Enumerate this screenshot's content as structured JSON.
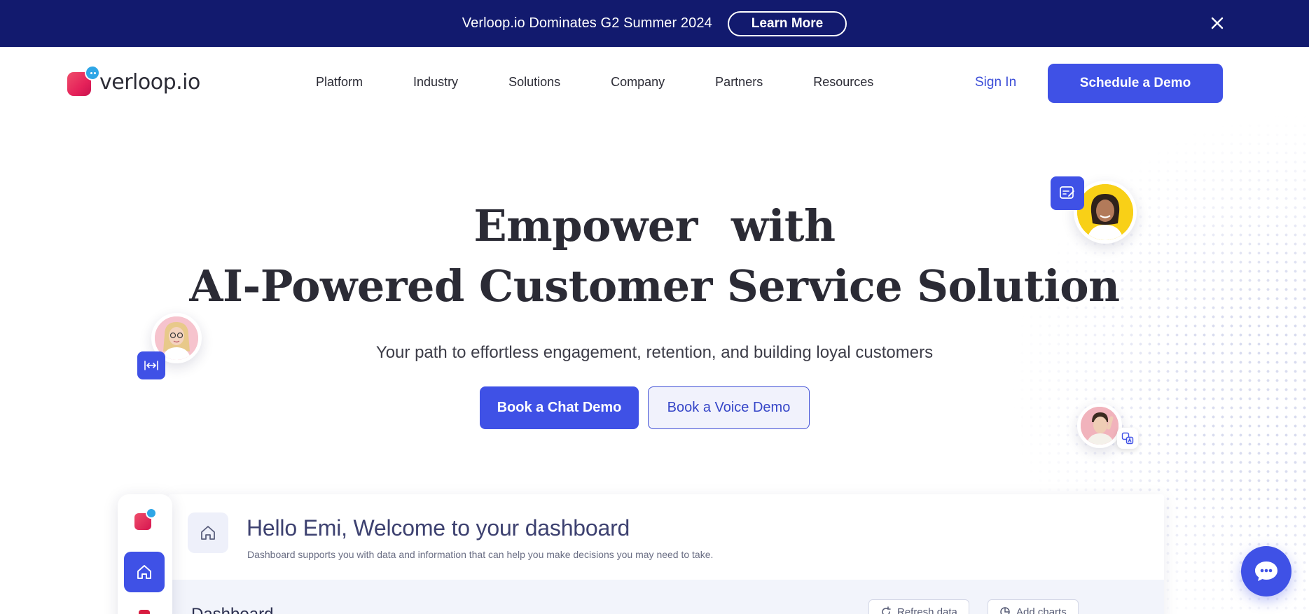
{
  "announcement": {
    "text": "Verloop.io Dominates G2 Summer 2024",
    "cta_label": "Learn More"
  },
  "nav": {
    "logo_text": "verloop.io",
    "links": [
      "Platform",
      "Industry",
      "Solutions",
      "Company",
      "Partners",
      "Resources"
    ],
    "signin_label": "Sign In",
    "schedule_label": "Schedule a Demo"
  },
  "hero": {
    "title_line1_a": "Empower",
    "title_line1_b": "with",
    "title_line2": "AI-Powered Customer Service Solution",
    "subtitle": "Your path to effortless engagement, retention, and building loyal customers",
    "chat_demo_label": "Book a Chat Demo",
    "voice_demo_label": "Book a Voice Demo"
  },
  "dashboard": {
    "greeting": "Hello Emi, Welcome to your dashboard",
    "description": "Dashboard supports you with data and information that can help you make decisions you may need to take.",
    "section_title": "Dashboard",
    "refresh_label": "Refresh data",
    "add_charts_label": "Add charts"
  },
  "icons": {
    "close": "close-icon",
    "home": "home-icon",
    "chat": "chat-bubble-icon",
    "form": "form-edit-icon",
    "resize": "resize-horizontal-icon",
    "translate": "translate-icon",
    "refresh": "refresh-icon",
    "chart": "pie-chart-icon"
  },
  "colors": {
    "announcement_bg": "#121a6e",
    "primary": "#3f51e6",
    "brand_pink": "#e5225a",
    "brand_blue": "#2ea6e6",
    "text_dark": "#2b2b35"
  }
}
